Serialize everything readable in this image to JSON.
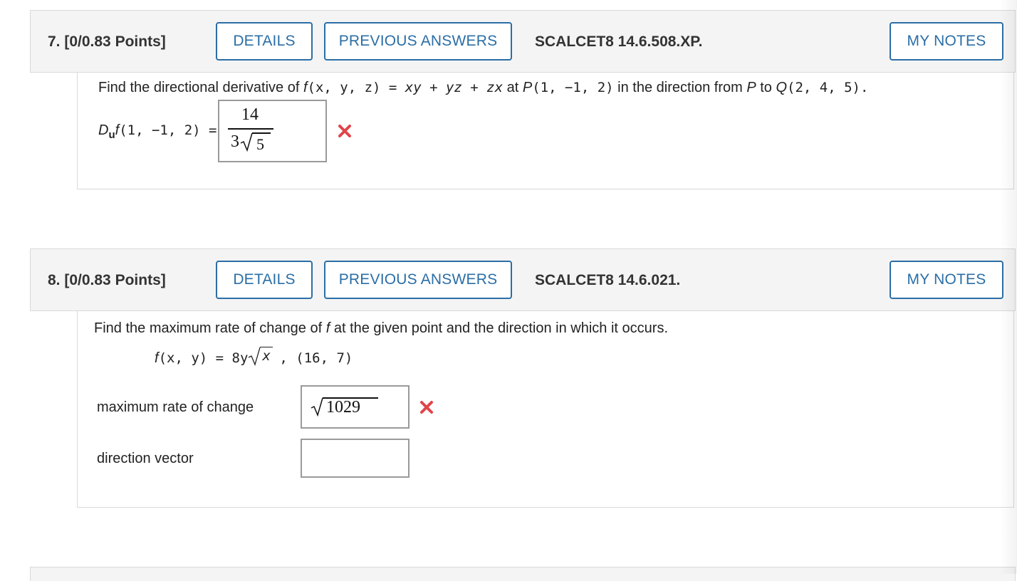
{
  "q7": {
    "number": "7.",
    "points": "[0/0.83 Points]",
    "details_label": "DETAILS",
    "prev_label": "PREVIOUS ANSWERS",
    "source": "SCALCET8 14.6.508.XP.",
    "notes_label": "MY NOTES",
    "prompt_pre": "Find the directional derivative of ",
    "f": "f",
    "func_args": "(x, y, z)",
    "equals": " = ",
    "func_expr": "xy + yz + zx",
    "at": " at ",
    "P": "P",
    "P_coords": "(1, −1, 2)",
    "dir_text": " in the direction from ",
    "to": " to ",
    "Q": "Q",
    "Q_coords": "(2, 4, 5).",
    "lhs_D": "D",
    "lhs_u": "u",
    "lhs_f": "f",
    "lhs_args": "(1, −1, 2) =",
    "answer_num": "14",
    "answer_den_coef": "3",
    "answer_den_rad": "5",
    "status": "incorrect"
  },
  "q8": {
    "number": "8.",
    "points": "[0/0.83 Points]",
    "details_label": "DETAILS",
    "prev_label": "PREVIOUS ANSWERS",
    "source": "SCALCET8 14.6.021.",
    "notes_label": "MY NOTES",
    "prompt_a": "Find the maximum rate of change of ",
    "prompt_f": "f",
    "prompt_b": " at the given point and the direction in which it occurs.",
    "f": "f",
    "func_lhs": "(x, y) = 8y",
    "func_rad": "x",
    "func_point": ",   (16, 7)",
    "max_rate_label": "maximum rate of change",
    "max_rate_value": "1029",
    "max_rate_status": "incorrect",
    "direction_label": "direction vector",
    "direction_value": ""
  },
  "colors": {
    "accent": "#2b6ea6",
    "error": "#e0444b"
  },
  "icons": {
    "incorrect": "x-mark-icon"
  }
}
